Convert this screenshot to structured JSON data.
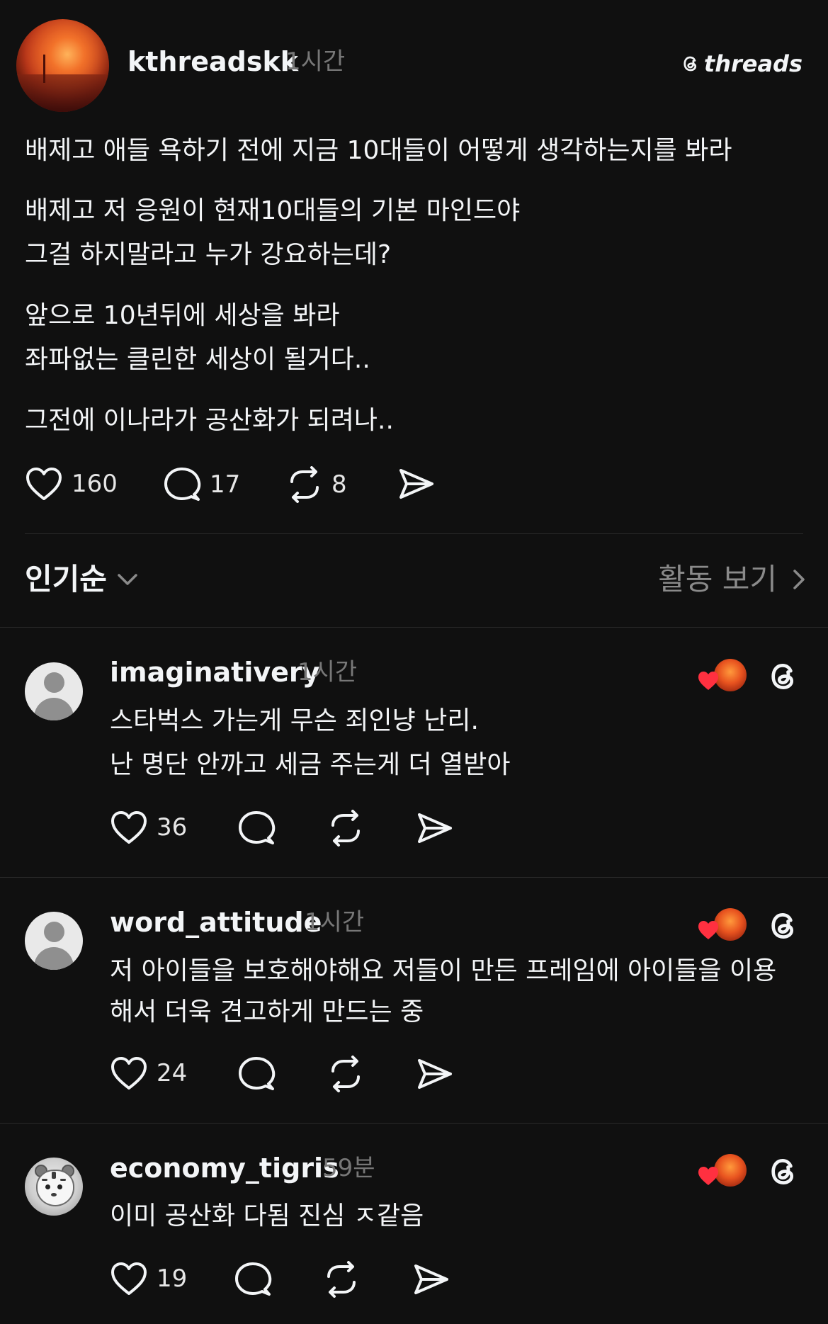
{
  "post": {
    "username": "kthreadskk",
    "time": "1시간",
    "brand": "threads",
    "paragraphs": [
      [
        "배제고 애들 욕하기 전에 지금 10대들이 어떻게 생각하는지를 봐라"
      ],
      [
        "배제고 저 응원이 현재10대들의 기본 마인드야",
        "그걸 하지말라고 누가 강요하는데?"
      ],
      [
        "앞으로 10년뒤에 세상을 봐라",
        "좌파없는 클린한 세상이 될거다.."
      ],
      [
        "그전에 이나라가 공산화가 되려나.."
      ]
    ],
    "likes": "160",
    "replies": "17",
    "reposts": "8"
  },
  "sort": {
    "label": "인기순",
    "activity": "활동 보기"
  },
  "comments": [
    {
      "username": "imaginativery",
      "time": "1시간",
      "lines": [
        "스타벅스 가는게 무슨 죄인냥 난리.",
        "난 명단 안까고 세금 주는게 더 열받아"
      ],
      "likes": "36"
    },
    {
      "username": "word_attitude",
      "time": "1시간",
      "lines": [
        "저 아이들을 보호해야해요 저들이 만든 프레임에 아이들을 이용",
        "해서 더욱 견고하게 만드는 중"
      ],
      "likes": "24"
    },
    {
      "username": "economy_tigris",
      "time": "59분",
      "lines": [
        "이미 공산화 다됨 진심 ㅈ같음"
      ],
      "likes": "19"
    }
  ],
  "icons": {
    "like": "heart-icon",
    "reply": "speech-bubble-icon",
    "repost": "repost-arrows-icon",
    "share": "paper-plane-icon",
    "threads_logo": "threads-logo-icon",
    "chevron_down": "chevron-down-icon",
    "chevron_right": "chevron-right-icon"
  },
  "colors": {
    "background": "#101010",
    "text": "#f3f5f7",
    "muted": "#777777",
    "like_red": "#ff3040",
    "divider": "#2a2a2a"
  }
}
